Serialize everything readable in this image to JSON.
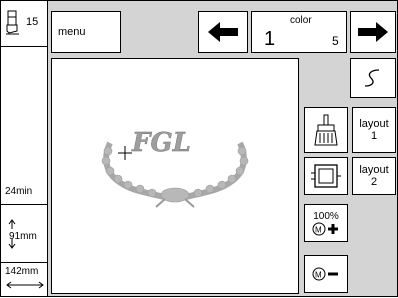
{
  "sidebar": {
    "stitch_number": "15",
    "time": "24min",
    "height": "91mm",
    "width": "142mm"
  },
  "toolbar": {
    "menu_label": "menu",
    "color_label": "color",
    "color_current": "1",
    "color_total": "5"
  },
  "design": {
    "monogram": "FGL"
  },
  "right_panel": {
    "layout1_label": "layout",
    "layout1_num": "1",
    "layout2_label": "layout",
    "layout2_num": "2",
    "zoom_pct": "100%",
    "icon_colors": {
      "accent": "#000000"
    }
  }
}
